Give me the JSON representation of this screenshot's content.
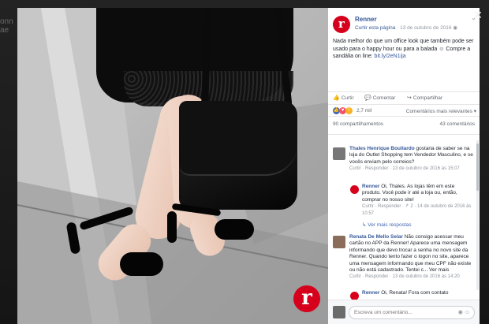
{
  "background": {
    "left_hint_lines": [
      "onn",
      "ae"
    ]
  },
  "viewer": {
    "close_icon": "close-icon"
  },
  "photo": {
    "brand_letter": "r"
  },
  "post": {
    "page_name": "Renner",
    "page_link": "Curtir esta página",
    "date": "13 de outubro de 2016",
    "text": "Nada melhor do que um office look que também pode ser usado para o happy hour ou para a balada ☺ Compre a sandália on line:",
    "url": "bit.ly/2eN1ija",
    "actions": {
      "like": "Curtir",
      "comment": "Comentar",
      "share": "Compartilhar"
    },
    "reaction_count": "2,7 mil",
    "sort_label": "Comentários mais relevantes ▾",
    "shares": "90 compartilhamentos",
    "comments_count": "43 comentários"
  },
  "comments": [
    {
      "name": "Thales Henrique Boullardo",
      "text": "gostaria de saber se na loja do Outlet Shopping tem Vendedor Masculino, e se vocês enviam pelo correios?",
      "actions": "Curtir · Responder · 13 de outubro de 2016 às 15:07"
    },
    {
      "name": "Renner",
      "text": "Oi, Thales. As lojas têm em este produto. Você pode ir até a loja ou, então, comprar no nosso site!",
      "actions": "Curtir · Responder · ↱ 2 · 14 de outubro de 2016 às 10:57"
    },
    {
      "view_more": "Ver mais respostas"
    },
    {
      "name": "Renata De Mello Selar",
      "text": "Não consigo acessar meu cartão no APP da Renner! Aparece uma mensagem informando que devo trocar a senha no novo site da Renner. Quando tento fazer o logon no site, aparece uma mensagem informando que meu CPF não existe ou não está cadastrado. Tentei c... Ver mais",
      "actions": "Curtir · Responder · 13 de outubro de 2016 às 14:20"
    },
    {
      "name": "Renner",
      "text": "Oi, Renata! Fora com contato"
    }
  ],
  "write_comment": {
    "placeholder": "Escreva um comentário..."
  },
  "colors": {
    "facebook_blue": "#365899",
    "renner_red": "#d6001c"
  }
}
